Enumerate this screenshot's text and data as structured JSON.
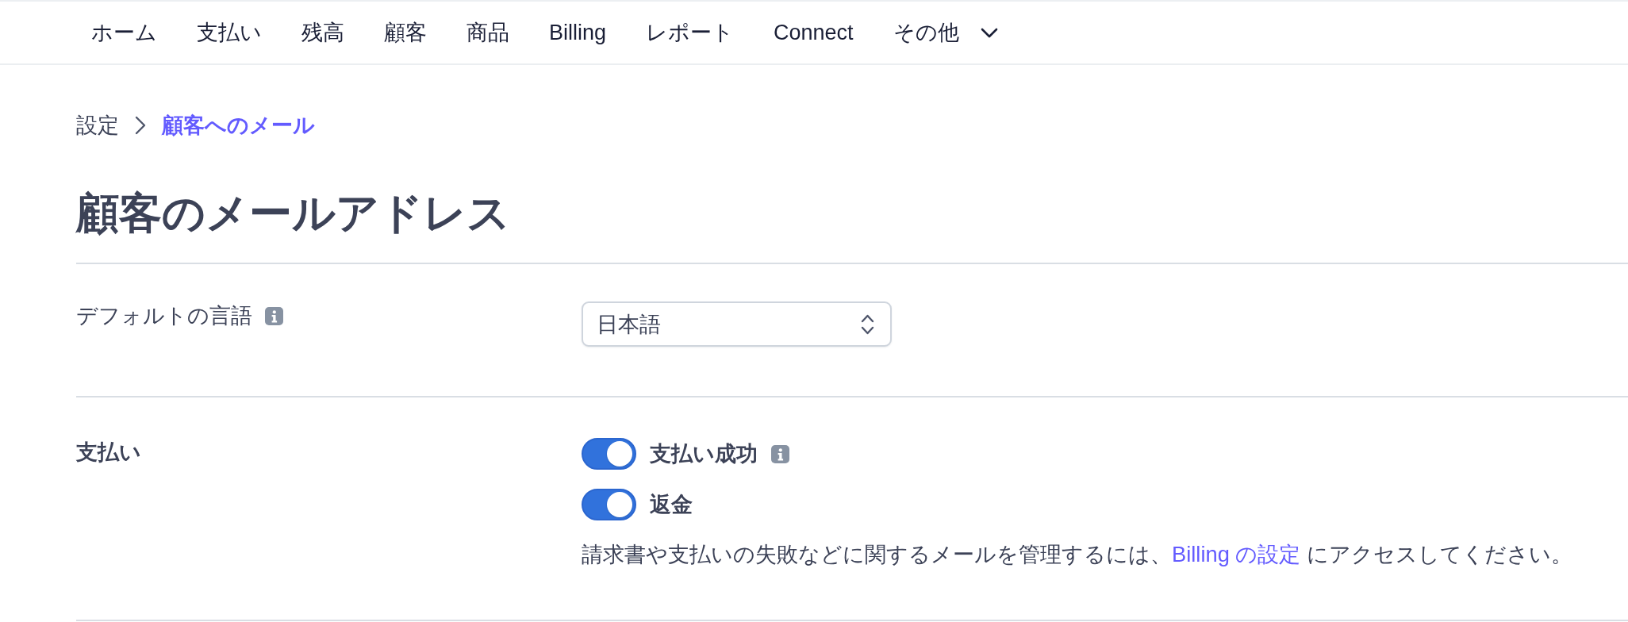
{
  "nav": {
    "items": [
      {
        "label": "ホーム",
        "kind": "link"
      },
      {
        "label": "支払い",
        "kind": "link"
      },
      {
        "label": "残高",
        "kind": "link"
      },
      {
        "label": "顧客",
        "kind": "link"
      },
      {
        "label": "商品",
        "kind": "link"
      },
      {
        "label": "Billing",
        "kind": "link"
      },
      {
        "label": "レポート",
        "kind": "link"
      },
      {
        "label": "Connect",
        "kind": "link"
      },
      {
        "label": "その他",
        "kind": "menu"
      }
    ]
  },
  "breadcrumb": [
    {
      "label": "設定",
      "current": false
    },
    {
      "label": "顧客へのメール",
      "current": true
    }
  ],
  "title": "顧客のメールアドレス",
  "sections": [
    {
      "kind": "select",
      "label": "デフォルトの言語",
      "info": true,
      "select": {
        "value": "日本語"
      }
    },
    {
      "kind": "toggles",
      "label": "支払い",
      "toggles": [
        {
          "label": "支払い成功",
          "on": true,
          "info": true
        },
        {
          "label": "返金",
          "on": true
        }
      ],
      "note": {
        "before": "請求書や支払いの失敗などに関するメールを管理するには、",
        "link": "Billing の設定",
        "after": " にアクセスしてください。"
      }
    }
  ]
}
